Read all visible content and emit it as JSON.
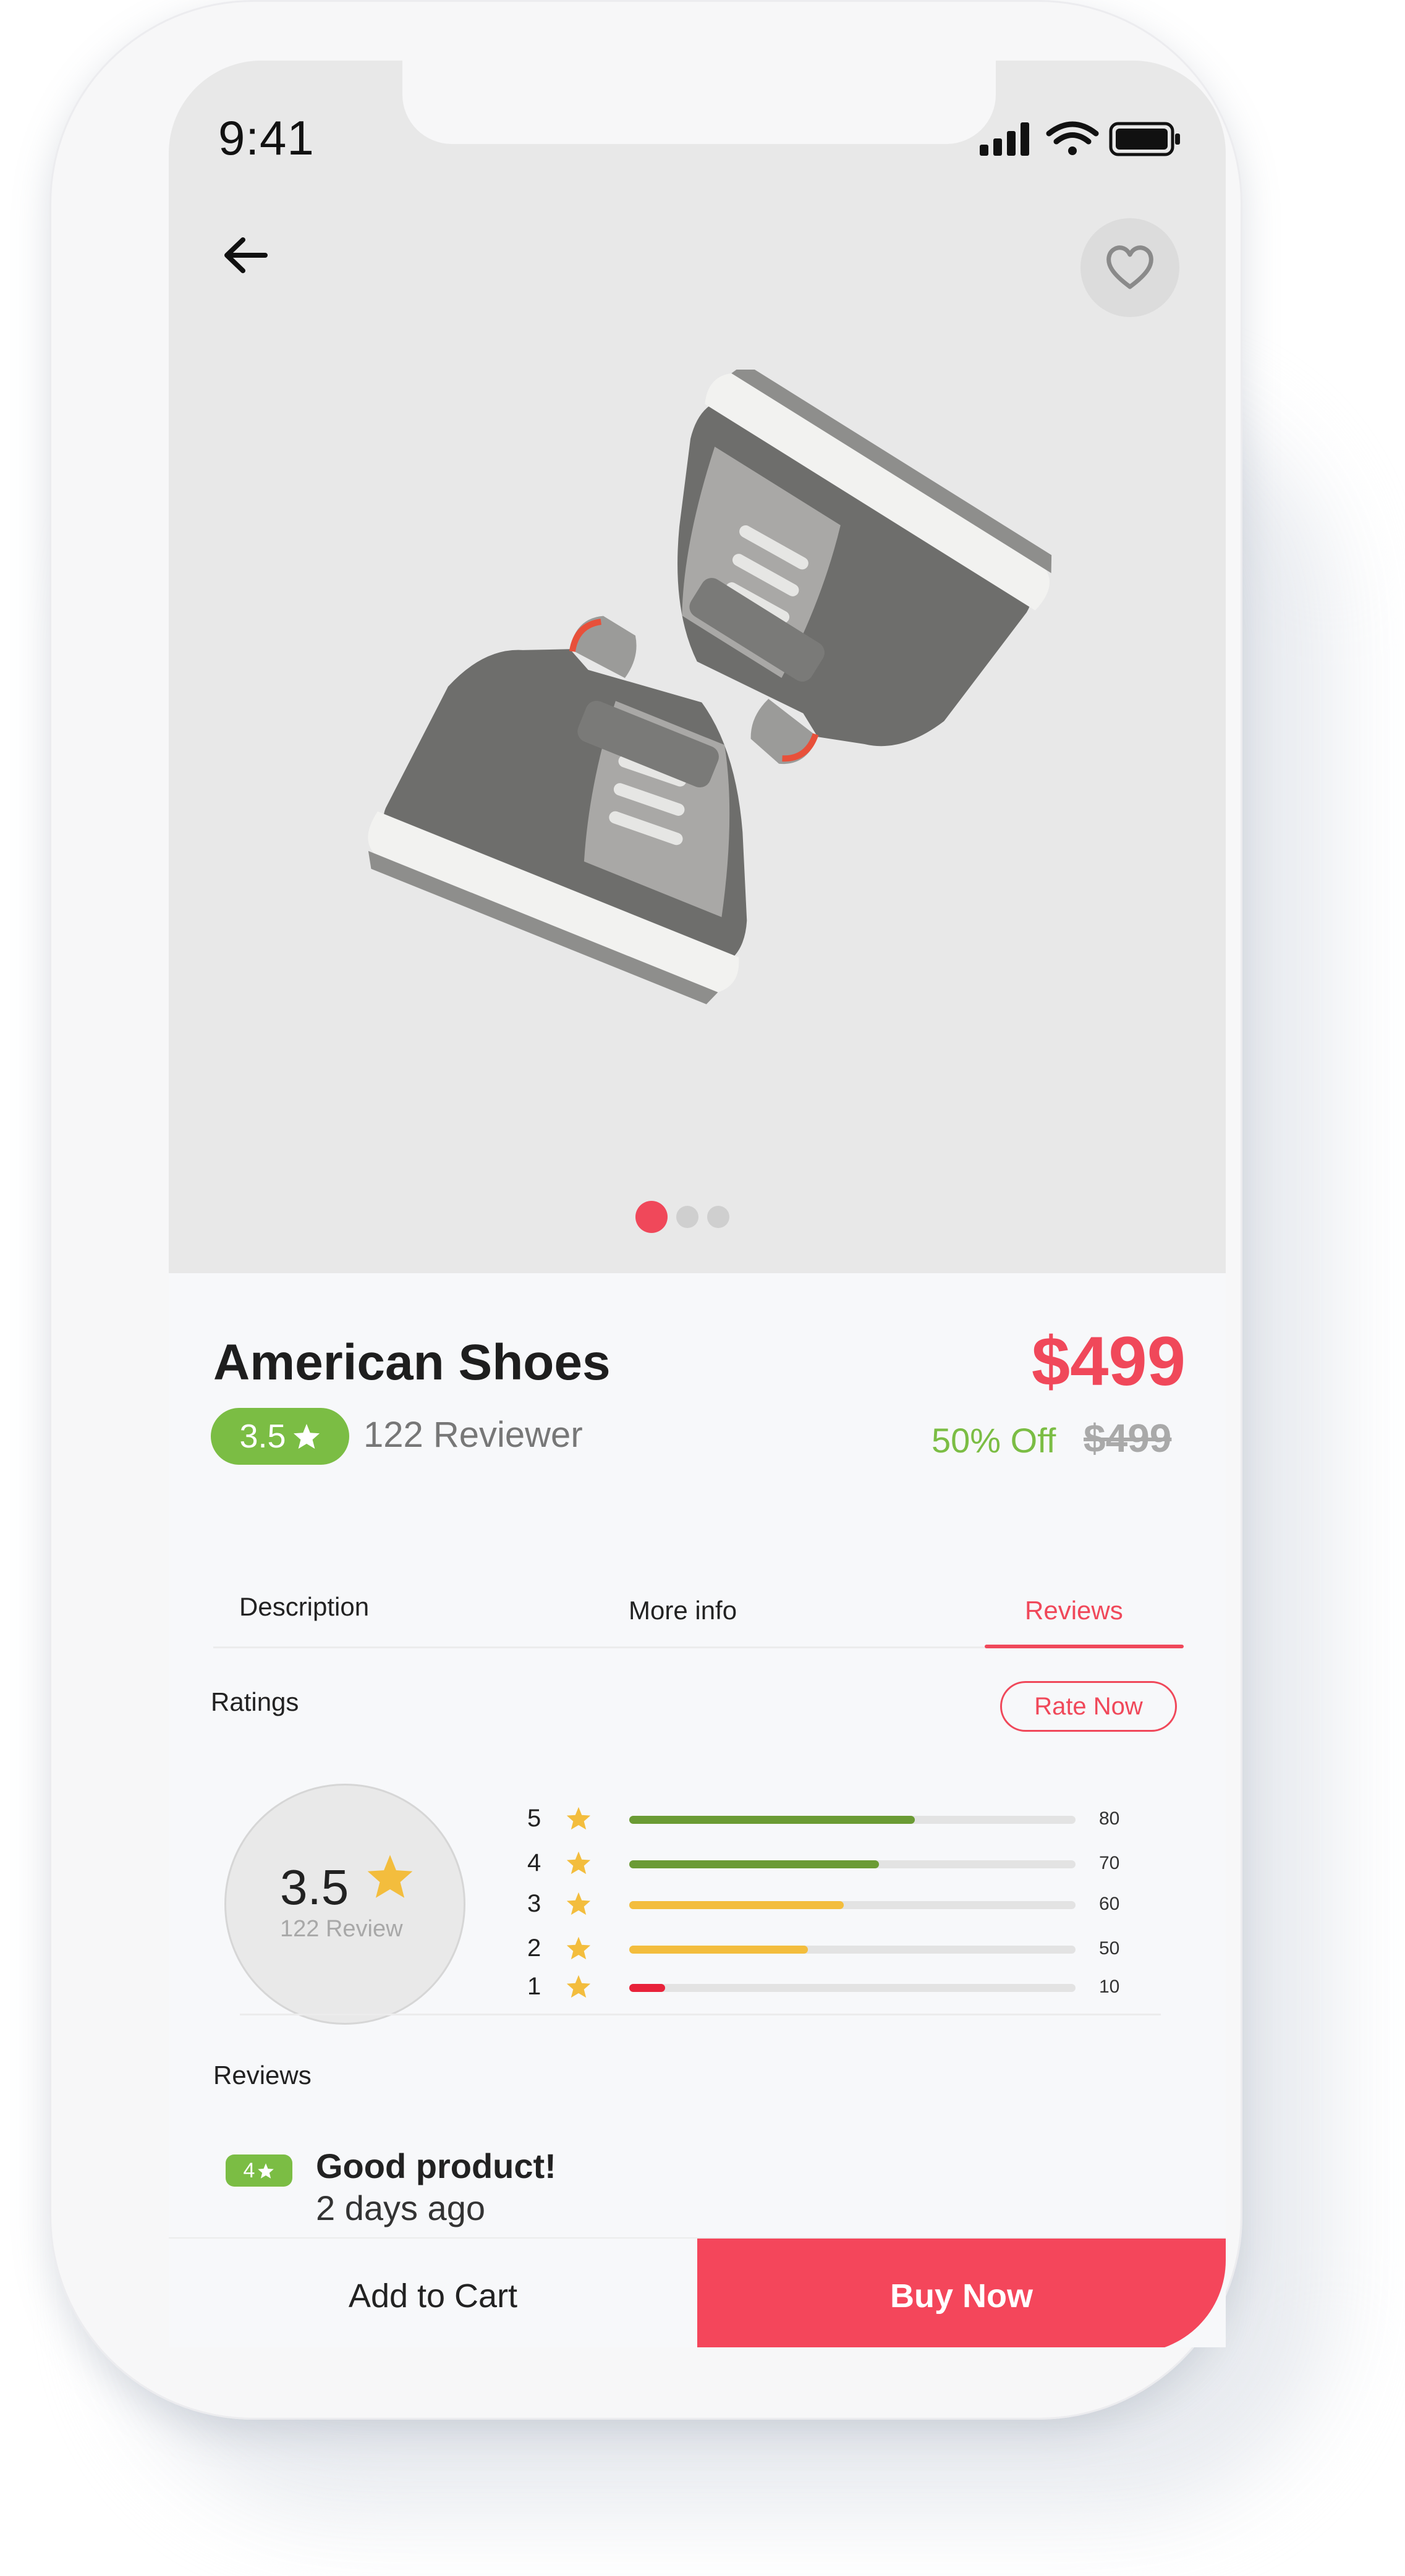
{
  "status_bar": {
    "time": "9:41"
  },
  "product": {
    "title": "American Shoes",
    "price": "$499",
    "rating": "3.5",
    "reviewer_count": "122 Reviewer",
    "discount": "50% Off",
    "old_price": "$499",
    "carousel": {
      "total": 3,
      "active_index": 0
    }
  },
  "tabs": [
    {
      "label": "Description",
      "active": false
    },
    {
      "label": "More info",
      "active": false
    },
    {
      "label": "Reviews",
      "active": true
    }
  ],
  "ratings": {
    "label": "Ratings",
    "rate_now_label": "Rate Now",
    "average": "3.5",
    "review_count_label": "122 Review",
    "breakdown": [
      {
        "stars": "5",
        "count": "80",
        "color": "#6b9b34"
      },
      {
        "stars": "4",
        "count": "70",
        "color": "#6b9b34"
      },
      {
        "stars": "3",
        "count": "60",
        "color": "#f3bd3d"
      },
      {
        "stars": "2",
        "count": "50",
        "color": "#f3bd3d"
      },
      {
        "stars": "1",
        "count": "10",
        "color": "#e8223a"
      }
    ]
  },
  "reviews_section": {
    "label": "Reviews",
    "items": [
      {
        "rating": "4",
        "title": "Good product!",
        "date": "2 days ago"
      }
    ]
  },
  "actions": {
    "add_to_cart": "Add to Cart",
    "buy_now": "Buy Now"
  },
  "colors": {
    "accent": "#f0485a",
    "positive": "#7bbd44",
    "star": "#f3bd3d"
  }
}
